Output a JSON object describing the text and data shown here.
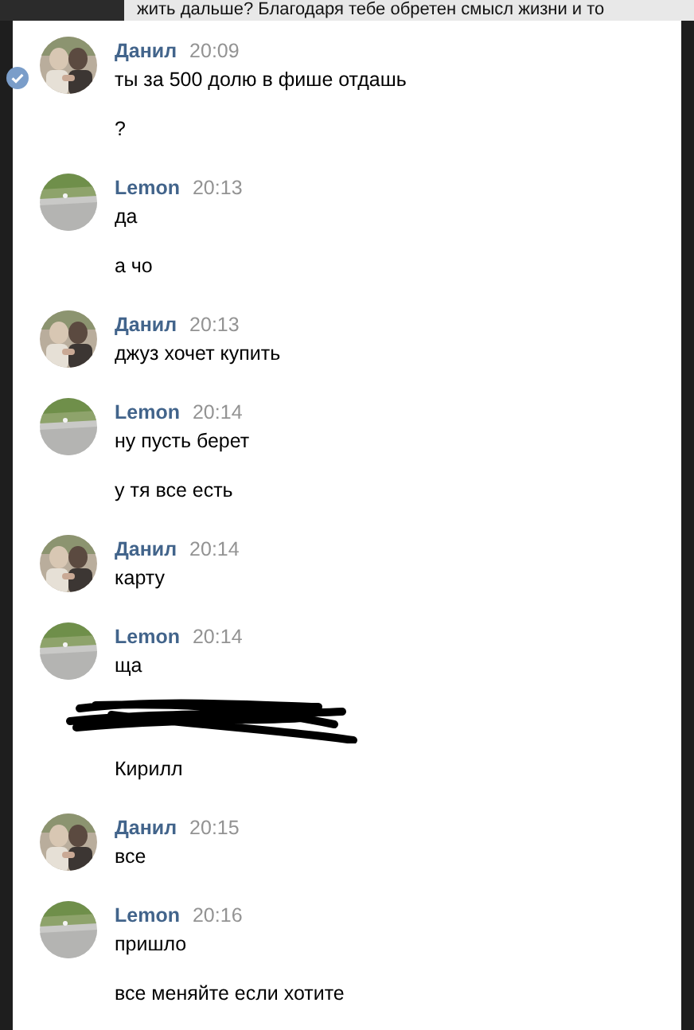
{
  "background_text": "жить дальше? Благодаря тебе обретен смысл жизни и то",
  "messages": [
    {
      "author": "Данил",
      "time": "20:09",
      "selected": true,
      "avatar": {
        "kind": "picture"
      },
      "lines": [
        {
          "kind": "text",
          "text": "ты за 500 долю в фише отдашь"
        },
        {
          "kind": "text",
          "text": "?"
        }
      ]
    },
    {
      "author": "Lemon",
      "time": "20:13",
      "selected": false,
      "avatar": {
        "kind": "picture"
      },
      "lines": [
        {
          "kind": "text",
          "text": "да"
        },
        {
          "kind": "text",
          "text": "а чо"
        }
      ]
    },
    {
      "author": "Данил",
      "time": "20:13",
      "selected": false,
      "avatar": {
        "kind": "picture"
      },
      "lines": [
        {
          "kind": "text",
          "text": "джуз хочет купить"
        }
      ]
    },
    {
      "author": "Lemon",
      "time": "20:14",
      "selected": false,
      "avatar": {
        "kind": "picture"
      },
      "lines": [
        {
          "kind": "text",
          "text": "ну пусть берет"
        },
        {
          "kind": "text",
          "text": "у тя все есть"
        }
      ]
    },
    {
      "author": "Данил",
      "time": "20:14",
      "selected": false,
      "avatar": {
        "kind": "picture"
      },
      "lines": [
        {
          "kind": "text",
          "text": "карту"
        }
      ]
    },
    {
      "author": "Lemon",
      "time": "20:14",
      "selected": false,
      "avatar": {
        "kind": "picture"
      },
      "lines": [
        {
          "kind": "text",
          "text": "ща"
        },
        {
          "kind": "redacted"
        },
        {
          "kind": "text",
          "text": "Кирилл"
        }
      ]
    },
    {
      "author": "Данил",
      "time": "20:15",
      "selected": false,
      "avatar": {
        "kind": "picture"
      },
      "lines": [
        {
          "kind": "text",
          "text": "все"
        }
      ]
    },
    {
      "author": "Lemon",
      "time": "20:16",
      "selected": false,
      "avatar": {
        "kind": "picture"
      },
      "lines": [
        {
          "kind": "text",
          "text": "пришло"
        },
        {
          "kind": "text",
          "text": "все меняйте если хотите"
        }
      ]
    }
  ]
}
